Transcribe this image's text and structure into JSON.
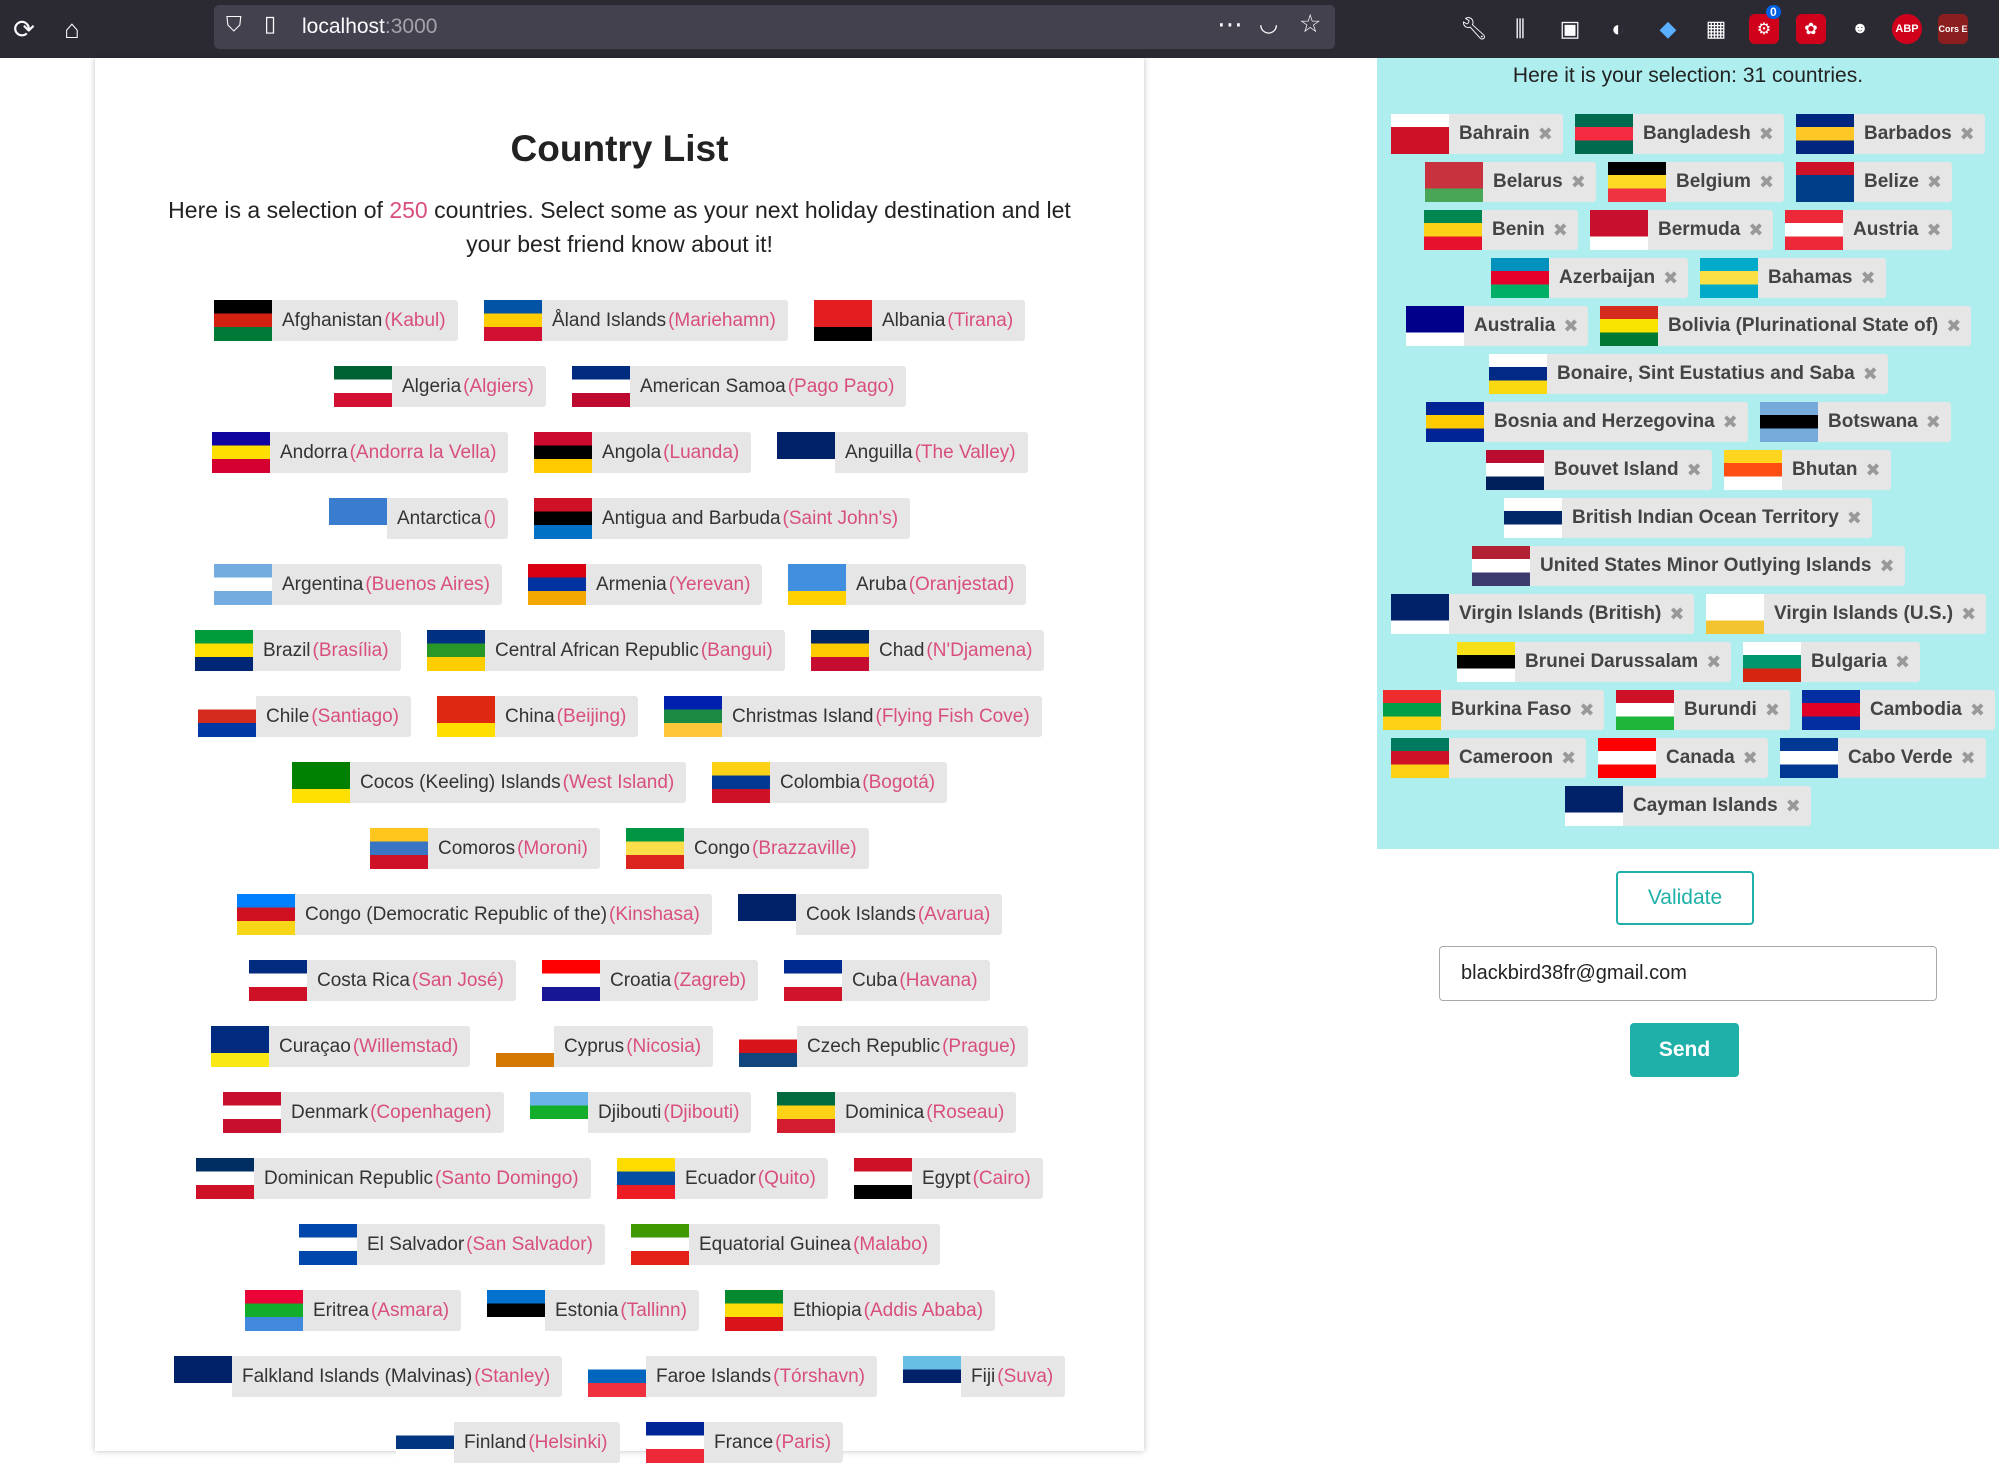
{
  "browser": {
    "url_host": "localhost",
    "url_port": ":3000",
    "icons": [
      "reload-icon",
      "home-icon",
      "shield-icon",
      "page-icon",
      "more-icon",
      "pocket-icon",
      "bookmark-star-icon",
      "wrench-icon",
      "library-icon",
      "sidebar-icon",
      "account-icon",
      "diamond-icon",
      "extension-icon",
      "gear-badge-icon",
      "puzzle-icon",
      "alien-icon",
      "adblock-icon",
      "cors-icon"
    ],
    "badge_count": "0",
    "adblock_label": "ABP",
    "cors_label": "Cors E"
  },
  "main": {
    "title": "Country List",
    "intro_before": "Here is a selection of ",
    "count": "250",
    "intro_after": " countries. Select some as your next holiday destination and let your best friend know about it!"
  },
  "countries": [
    {
      "name": "Afghanistan",
      "capital": "(Kabul)",
      "flag": [
        "#000",
        "#d32011",
        "#007a36"
      ]
    },
    {
      "name": "Åland Islands",
      "capital": "(Mariehamn)",
      "flag": [
        "#0053a5",
        "#ffce00",
        "#d21034"
      ]
    },
    {
      "name": "Albania",
      "capital": "(Tirana)",
      "flag": [
        "#e41e20",
        "#e41e20",
        "#000"
      ]
    },
    {
      "name": "Algeria",
      "capital": "(Algiers)",
      "flag": [
        "#006233",
        "#fff",
        "#d21034"
      ]
    },
    {
      "name": "American Samoa",
      "capital": "(Pago Pago)",
      "flag": [
        "#002b7f",
        "#fff",
        "#bf0a30"
      ]
    },
    {
      "name": "Andorra",
      "capital": "(Andorra la Vella)",
      "flag": [
        "#10069f",
        "#fedf00",
        "#d50032"
      ]
    },
    {
      "name": "Angola",
      "capital": "(Luanda)",
      "flag": [
        "#cc092f",
        "#000",
        "#ffcb00"
      ]
    },
    {
      "name": "Anguilla",
      "capital": "(The Valley)",
      "flag": [
        "#012169",
        "#012169",
        "#fff"
      ]
    },
    {
      "name": "Antarctica",
      "capital": "()",
      "flag": [
        "#3a7dce",
        "#3a7dce",
        "#fff"
      ]
    },
    {
      "name": "Antigua and Barbuda",
      "capital": "(Saint John's)",
      "flag": [
        "#ce1126",
        "#000",
        "#0072c6"
      ]
    },
    {
      "name": "Argentina",
      "capital": "(Buenos Aires)",
      "flag": [
        "#74acdf",
        "#fff",
        "#74acdf"
      ]
    },
    {
      "name": "Armenia",
      "capital": "(Yerevan)",
      "flag": [
        "#d90012",
        "#0033a0",
        "#f2a800"
      ]
    },
    {
      "name": "Aruba",
      "capital": "(Oranjestad)",
      "flag": [
        "#418fde",
        "#418fde",
        "#ffd100"
      ]
    },
    {
      "name": "Brazil",
      "capital": "(Brasília)",
      "flag": [
        "#009c3b",
        "#ffdf00",
        "#002776"
      ]
    },
    {
      "name": "Central African Republic",
      "capital": "(Bangui)",
      "flag": [
        "#003082",
        "#289728",
        "#ffce00"
      ]
    },
    {
      "name": "Chad",
      "capital": "(N'Djamena)",
      "flag": [
        "#002664",
        "#fecb00",
        "#c60c30"
      ]
    },
    {
      "name": "Chile",
      "capital": "(Santiago)",
      "flag": [
        "#fff",
        "#d52b1e",
        "#0039a6"
      ]
    },
    {
      "name": "China",
      "capital": "(Beijing)",
      "flag": [
        "#de2910",
        "#de2910",
        "#ffde00"
      ]
    },
    {
      "name": "Christmas Island",
      "capital": "(Flying Fish Cove)",
      "flag": [
        "#0021ad",
        "#1c8a42",
        "#ffc639"
      ]
    },
    {
      "name": "Cocos (Keeling) Islands",
      "capital": "(West Island)",
      "flag": [
        "#008000",
        "#008000",
        "#ffe000"
      ]
    },
    {
      "name": "Colombia",
      "capital": "(Bogotá)",
      "flag": [
        "#fcd116",
        "#003893",
        "#ce1126"
      ]
    },
    {
      "name": "Comoros",
      "capital": "(Moroni)",
      "flag": [
        "#ffc61e",
        "#3a75c4",
        "#ce1126"
      ]
    },
    {
      "name": "Congo",
      "capital": "(Brazzaville)",
      "flag": [
        "#009543",
        "#fbde4a",
        "#dc241f"
      ]
    },
    {
      "name": "Congo (Democratic Republic of the)",
      "capital": "(Kinshasa)",
      "flag": [
        "#007fff",
        "#ce1021",
        "#f7d618"
      ]
    },
    {
      "name": "Cook Islands",
      "capital": "(Avarua)",
      "flag": [
        "#012169",
        "#012169",
        "#fff"
      ]
    },
    {
      "name": "Costa Rica",
      "capital": "(San José)",
      "flag": [
        "#002b7f",
        "#fff",
        "#ce1126"
      ]
    },
    {
      "name": "Croatia",
      "capital": "(Zagreb)",
      "flag": [
        "#ff0000",
        "#fff",
        "#171796"
      ]
    },
    {
      "name": "Cuba",
      "capital": "(Havana)",
      "flag": [
        "#002a8f",
        "#fff",
        "#cf142b"
      ]
    },
    {
      "name": "Curaçao",
      "capital": "(Willemstad)",
      "flag": [
        "#002b7f",
        "#002b7f",
        "#f9e814"
      ]
    },
    {
      "name": "Cyprus",
      "capital": "(Nicosia)",
      "flag": [
        "#fff",
        "#fff",
        "#d57800"
      ]
    },
    {
      "name": "Czech Republic",
      "capital": "(Prague)",
      "flag": [
        "#fff",
        "#d7141a",
        "#11457e"
      ]
    },
    {
      "name": "Denmark",
      "capital": "(Copenhagen)",
      "flag": [
        "#c8102e",
        "#fff",
        "#c8102e"
      ]
    },
    {
      "name": "Djibouti",
      "capital": "(Djibouti)",
      "flag": [
        "#6ab2e7",
        "#12ad2b",
        "#fff"
      ]
    },
    {
      "name": "Dominica",
      "capital": "(Roseau)",
      "flag": [
        "#006b3f",
        "#fcd116",
        "#d41c30"
      ]
    },
    {
      "name": "Dominican Republic",
      "capital": "(Santo Domingo)",
      "flag": [
        "#002d62",
        "#fff",
        "#ce1126"
      ]
    },
    {
      "name": "Ecuador",
      "capital": "(Quito)",
      "flag": [
        "#ffdd00",
        "#034ea2",
        "#ed1c24"
      ]
    },
    {
      "name": "Egypt",
      "capital": "(Cairo)",
      "flag": [
        "#ce1126",
        "#fff",
        "#000"
      ]
    },
    {
      "name": "El Salvador",
      "capital": "(San Salvador)",
      "flag": [
        "#0047ab",
        "#fff",
        "#0047ab"
      ]
    },
    {
      "name": "Equatorial Guinea",
      "capital": "(Malabo)",
      "flag": [
        "#3e9a00",
        "#fff",
        "#e32118"
      ]
    },
    {
      "name": "Eritrea",
      "capital": "(Asmara)",
      "flag": [
        "#ea0437",
        "#12ad2b",
        "#4189dd"
      ]
    },
    {
      "name": "Estonia",
      "capital": "(Tallinn)",
      "flag": [
        "#0072ce",
        "#000",
        "#fff"
      ]
    },
    {
      "name": "Ethiopia",
      "capital": "(Addis Ababa)",
      "flag": [
        "#078930",
        "#fcdd09",
        "#da121a"
      ]
    },
    {
      "name": "Falkland Islands (Malvinas)",
      "capital": "(Stanley)",
      "flag": [
        "#012169",
        "#012169",
        "#fff"
      ]
    },
    {
      "name": "Faroe Islands",
      "capital": "(Tórshavn)",
      "flag": [
        "#fff",
        "#0065bd",
        "#ef303e"
      ]
    },
    {
      "name": "Fiji",
      "capital": "(Suva)",
      "flag": [
        "#68bfe5",
        "#012169",
        "#fff"
      ]
    },
    {
      "name": "Finland",
      "capital": "(Helsinki)",
      "flag": [
        "#fff",
        "#003580",
        "#fff"
      ]
    },
    {
      "name": "France",
      "capital": "(Paris)",
      "flag": [
        "#002395",
        "#fff",
        "#ed2939"
      ]
    }
  ],
  "panel": {
    "title": "Here it is your selection: 31 countries.",
    "close_glyph": "✖",
    "selected": [
      {
        "name": "Bahrain",
        "flag": [
          "#fff",
          "#ce1126",
          "#ce1126"
        ]
      },
      {
        "name": "Bangladesh",
        "flag": [
          "#006a4e",
          "#f42a41",
          "#006a4e"
        ]
      },
      {
        "name": "Barbados",
        "flag": [
          "#00267f",
          "#ffc726",
          "#00267f"
        ]
      },
      {
        "name": "Belarus",
        "flag": [
          "#c8313e",
          "#c8313e",
          "#4aa657"
        ]
      },
      {
        "name": "Belgium",
        "flag": [
          "#000",
          "#fdda24",
          "#ef3340"
        ]
      },
      {
        "name": "Belize",
        "flag": [
          "#ce1126",
          "#003f87",
          "#003f87"
        ]
      },
      {
        "name": "Benin",
        "flag": [
          "#008751",
          "#fcd116",
          "#e8112d"
        ]
      },
      {
        "name": "Bermuda",
        "flag": [
          "#c8102e",
          "#c8102e",
          "#fff"
        ]
      },
      {
        "name": "Austria",
        "flag": [
          "#ed2939",
          "#fff",
          "#ed2939"
        ]
      },
      {
        "name": "Azerbaijan",
        "flag": [
          "#0092bc",
          "#e4002b",
          "#00af66"
        ]
      },
      {
        "name": "Bahamas",
        "flag": [
          "#00abc9",
          "#fae042",
          "#00abc9"
        ]
      },
      {
        "name": "Australia",
        "flag": [
          "#00008b",
          "#00008b",
          "#fff"
        ]
      },
      {
        "name": "Bolivia (Plurinational State of)",
        "flag": [
          "#d52b1e",
          "#f9e300",
          "#007934"
        ]
      },
      {
        "name": "Bonaire, Sint Eustatius and Saba",
        "flag": [
          "#fff",
          "#012a87",
          "#f9d90f"
        ]
      },
      {
        "name": "Bosnia and Herzegovina",
        "flag": [
          "#002395",
          "#fecb00",
          "#002395"
        ]
      },
      {
        "name": "Botswana",
        "flag": [
          "#75aadb",
          "#000",
          "#75aadb"
        ]
      },
      {
        "name": "Bouvet Island",
        "flag": [
          "#ba0c2f",
          "#fff",
          "#00205b"
        ]
      },
      {
        "name": "Bhutan",
        "flag": [
          "#ffd520",
          "#ff4e12",
          "#fff"
        ]
      },
      {
        "name": "British Indian Ocean Territory",
        "flag": [
          "#fff",
          "#002868",
          "#fff"
        ]
      },
      {
        "name": "United States Minor Outlying Islands",
        "flag": [
          "#b22234",
          "#fff",
          "#3c3b6e"
        ]
      },
      {
        "name": "Virgin Islands (British)",
        "flag": [
          "#012169",
          "#012169",
          "#fff"
        ]
      },
      {
        "name": "Virgin Islands (U.S.)",
        "flag": [
          "#fff",
          "#fff",
          "#f4c430"
        ]
      },
      {
        "name": "Brunei Darussalam",
        "flag": [
          "#f7e017",
          "#000",
          "#fff"
        ]
      },
      {
        "name": "Bulgaria",
        "flag": [
          "#fff",
          "#00966e",
          "#d62612"
        ]
      },
      {
        "name": "Burkina Faso",
        "flag": [
          "#ef2b2d",
          "#009e49",
          "#fcd116"
        ]
      },
      {
        "name": "Burundi",
        "flag": [
          "#ce1126",
          "#fff",
          "#1eb53a"
        ]
      },
      {
        "name": "Cambodia",
        "flag": [
          "#032ea1",
          "#e00025",
          "#032ea1"
        ]
      },
      {
        "name": "Cameroon",
        "flag": [
          "#007a5e",
          "#ce1126",
          "#fcd116"
        ]
      },
      {
        "name": "Canada",
        "flag": [
          "#ff0000",
          "#fff",
          "#ff0000"
        ]
      },
      {
        "name": "Cabo Verde",
        "flag": [
          "#003893",
          "#fff",
          "#003893"
        ]
      },
      {
        "name": "Cayman Islands",
        "flag": [
          "#012169",
          "#012169",
          "#fff"
        ]
      }
    ]
  },
  "form": {
    "validate_label": "Validate",
    "email_value": "blackbird38fr@gmail.com",
    "send_label": "Send"
  }
}
